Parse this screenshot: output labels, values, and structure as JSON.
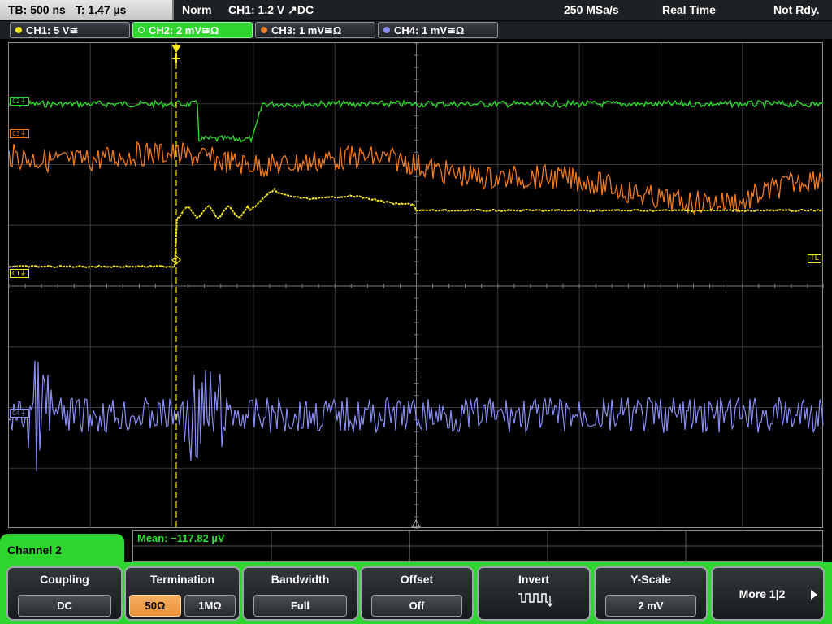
{
  "header": {
    "timebase": "TB: 500 ns",
    "trigger_time": "T: 1.47 µs",
    "trigger_mode": "Norm",
    "trigger_info": "CH1: 1.2 V ↗DC",
    "sample_rate": "250 MSa/s",
    "acq_mode": "Real Time",
    "status": "Not Rdy."
  },
  "channels": [
    {
      "label": "CH1: 5 V≅",
      "color": "#f5e61e",
      "ref_label": "C1⏚"
    },
    {
      "label": "CH2: 2 mV≅Ω",
      "color": "#2fd62f",
      "ref_label": "C2⏚"
    },
    {
      "label": "CH3: 1 mV≅Ω",
      "color": "#f07a1e",
      "ref_label": "C3⏚"
    },
    {
      "label": "CH4: 1 mV≅Ω",
      "color": "#8a8ff5",
      "ref_label": "C4⏚"
    }
  ],
  "trigger_level_label": "TL",
  "measurement": {
    "text": "Mean: −117.82 µV"
  },
  "menu": {
    "title": "Channel 2",
    "coupling": {
      "label": "Coupling",
      "value": "DC"
    },
    "termination": {
      "label": "Termination",
      "option1": "50Ω",
      "option2": "1MΩ"
    },
    "bandwidth": {
      "label": "Bandwidth",
      "value": "Full"
    },
    "offset": {
      "label": "Offset",
      "value": "Off"
    },
    "invert": {
      "label": "Invert",
      "icon": "invert-waveform-icon"
    },
    "yscale": {
      "label": "Y-Scale",
      "value": "2 mV"
    },
    "more": {
      "label": "More 1|2",
      "icon": "arrow-right-icon"
    }
  }
}
